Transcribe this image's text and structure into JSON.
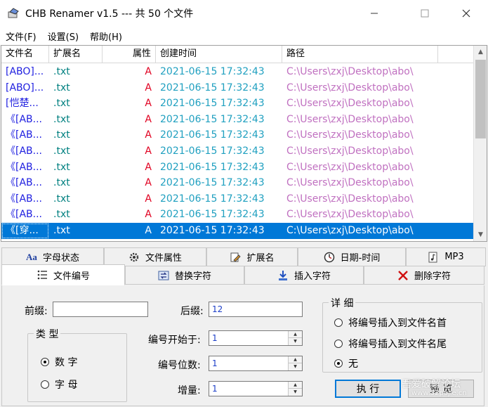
{
  "window": {
    "title": "CHB Renamer v1.5 --- 共 50 个文件",
    "min_glyph": "—",
    "max_glyph": "☐",
    "close_glyph": "✕"
  },
  "menu": [
    "文件(F)",
    "设置(S)",
    "帮助(H)"
  ],
  "list": {
    "columns": [
      "文件名",
      "扩展名",
      "属性",
      "创建时间",
      "路径"
    ],
    "rows": [
      {
        "name": "[ABO]...",
        "ext": ".txt",
        "attr": "A",
        "time": "2021-06-15 17:32:43",
        "path": "C:\\Users\\zxj\\Desktop\\abo\\"
      },
      {
        "name": "[ABO]...",
        "ext": ".txt",
        "attr": "A",
        "time": "2021-06-15 17:32:43",
        "path": "C:\\Users\\zxj\\Desktop\\abo\\"
      },
      {
        "name": "[恺楚...",
        "ext": ".txt",
        "attr": "A",
        "time": "2021-06-15 17:32:43",
        "path": "C:\\Users\\zxj\\Desktop\\abo\\"
      },
      {
        "name": "《[AB...",
        "ext": ".txt",
        "attr": "A",
        "time": "2021-06-15 17:32:43",
        "path": "C:\\Users\\zxj\\Desktop\\abo\\"
      },
      {
        "name": "《[AB...",
        "ext": ".txt",
        "attr": "A",
        "time": "2021-06-15 17:32:43",
        "path": "C:\\Users\\zxj\\Desktop\\abo\\"
      },
      {
        "name": "《[AB...",
        "ext": ".txt",
        "attr": "A",
        "time": "2021-06-15 17:32:43",
        "path": "C:\\Users\\zxj\\Desktop\\abo\\"
      },
      {
        "name": "《[AB...",
        "ext": ".txt",
        "attr": "A",
        "time": "2021-06-15 17:32:43",
        "path": "C:\\Users\\zxj\\Desktop\\abo\\"
      },
      {
        "name": "《[AB...",
        "ext": ".txt",
        "attr": "A",
        "time": "2021-06-15 17:32:43",
        "path": "C:\\Users\\zxj\\Desktop\\abo\\"
      },
      {
        "name": "《[AB...",
        "ext": ".txt",
        "attr": "A",
        "time": "2021-06-15 17:32:43",
        "path": "C:\\Users\\zxj\\Desktop\\abo\\"
      },
      {
        "name": "《[AB...",
        "ext": ".txt",
        "attr": "A",
        "time": "2021-06-15 17:32:43",
        "path": "C:\\Users\\zxj\\Desktop\\abo\\"
      },
      {
        "name": "《[穿...",
        "ext": ".txt",
        "attr": "A",
        "time": "2021-06-15 17:32:43",
        "path": "C:\\Users\\zxj\\Desktop\\abo\\",
        "selected": true
      }
    ]
  },
  "tabs_top": [
    {
      "label": "字母状态",
      "icon": "Aa"
    },
    {
      "label": "文件属性",
      "icon": "gear-icon"
    },
    {
      "label": "扩展名",
      "icon": "pencil-doc-icon"
    },
    {
      "label": "日期-时间",
      "icon": "clock-icon"
    },
    {
      "label": "MP3",
      "icon": "music-doc-icon"
    }
  ],
  "tabs_bottom": [
    {
      "label": "文件编号",
      "icon": "numbered-list-icon",
      "active": true
    },
    {
      "label": "替换字符",
      "icon": "replace-icon"
    },
    {
      "label": "插入字符",
      "icon": "insert-arrow-icon"
    },
    {
      "label": "删除字符",
      "icon": "delete-x-icon"
    }
  ],
  "form": {
    "prefix_label": "前缀:",
    "prefix_value": "",
    "suffix_label": "后缀:",
    "suffix_value": "12",
    "start_label": "编号开始于:",
    "start_value": "1",
    "digits_label": "编号位数:",
    "digits_value": "1",
    "increment_label": "增量:",
    "increment_value": "1",
    "type_group": "类 型",
    "type_number": "数 字",
    "type_letter": "字 母",
    "type_selected": "number",
    "detail_group": "详 细",
    "detail_opt1": "将编号插入到文件名首",
    "detail_opt2": "将编号插入到文件名尾",
    "detail_opt3": "无",
    "detail_selected": 3
  },
  "buttons": {
    "execute": "执 行",
    "preview": "预 览"
  },
  "watermark": {
    "main": "吾爱破解论坛",
    "sub": "www.52pojie.cn"
  },
  "colors": {
    "name": "#2020e0",
    "ext": "#008080",
    "attr": "#e00020",
    "time": "#20a0c0",
    "path": "#c070c0",
    "selection": "#0078d7"
  }
}
